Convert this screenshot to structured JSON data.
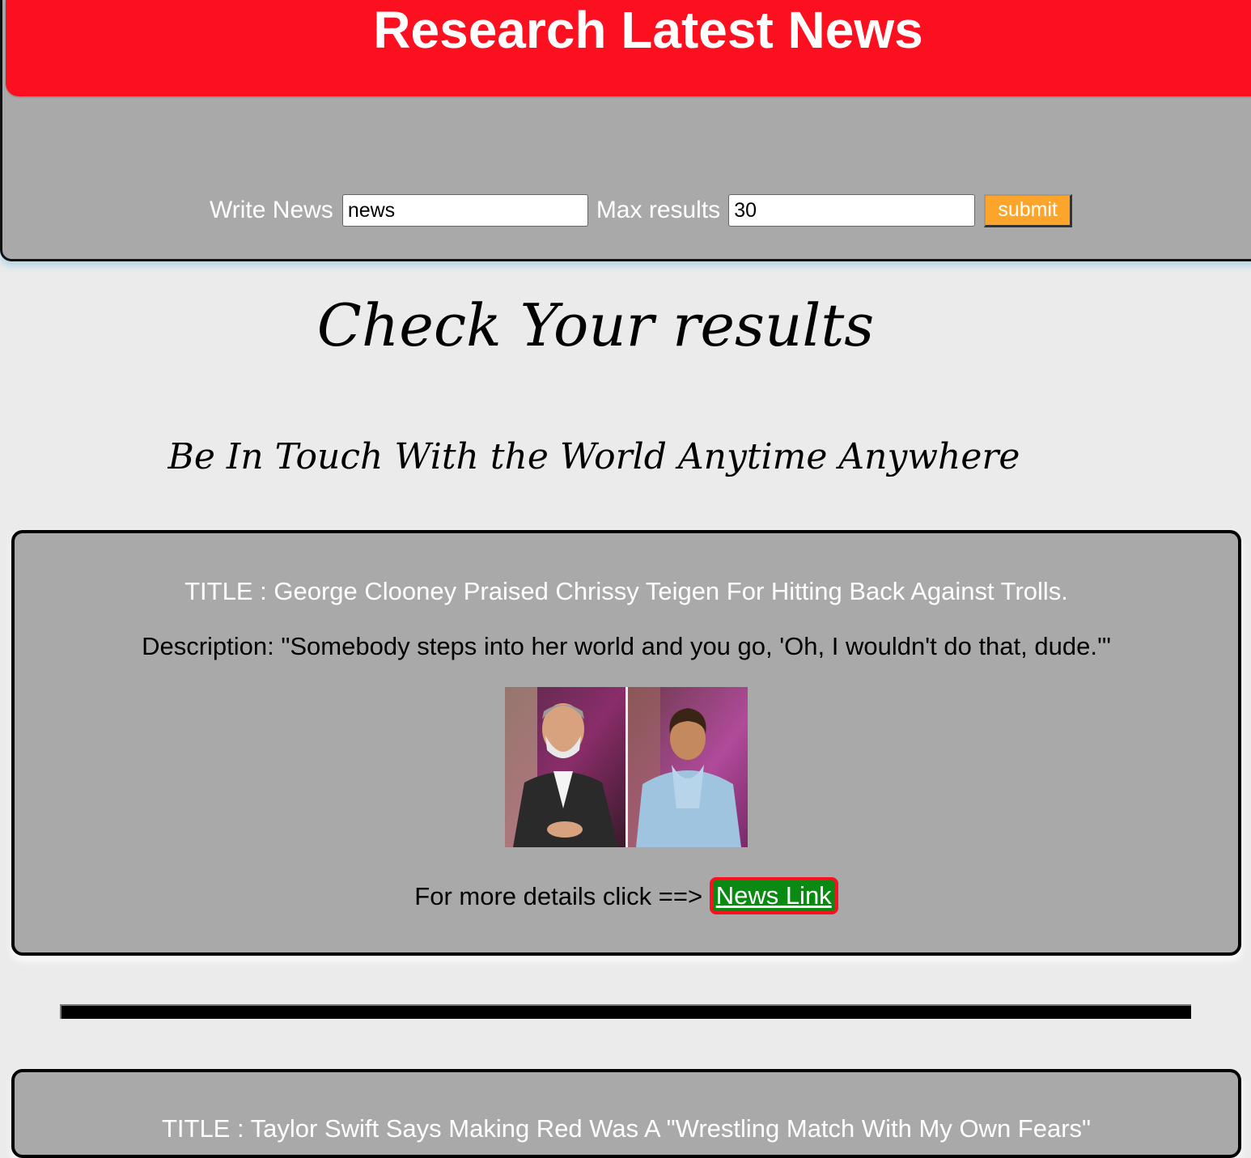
{
  "header": {
    "title": "Research Latest News"
  },
  "search": {
    "news_label": "Write News",
    "news_value": "news",
    "max_label": "Max results",
    "max_value": "30",
    "submit_label": "submit"
  },
  "results_heading": "Check Your results",
  "tagline": "Be In Touch With the World Anytime Anywhere",
  "articles": [
    {
      "title": "TITLE : George Clooney Praised Chrissy Teigen For Hitting Back Against Trolls.",
      "description": "Description: \"Somebody steps into her world and you go, 'Oh, I wouldn't do that, dude.'\"",
      "details_text": "For more details click ==> ",
      "link_label": "News Link"
    },
    {
      "title": "TITLE : Taylor Swift Says Making Red Was A \"Wrestling Match With My Own Fears\""
    }
  ],
  "colors": {
    "title_bar": "#fc1020",
    "panel_gray": "#a9a9a9",
    "page_background": "#ebebeb",
    "submit_button": "#fda52a",
    "link_background": "#0a8a12",
    "link_border": "#fc1020"
  }
}
